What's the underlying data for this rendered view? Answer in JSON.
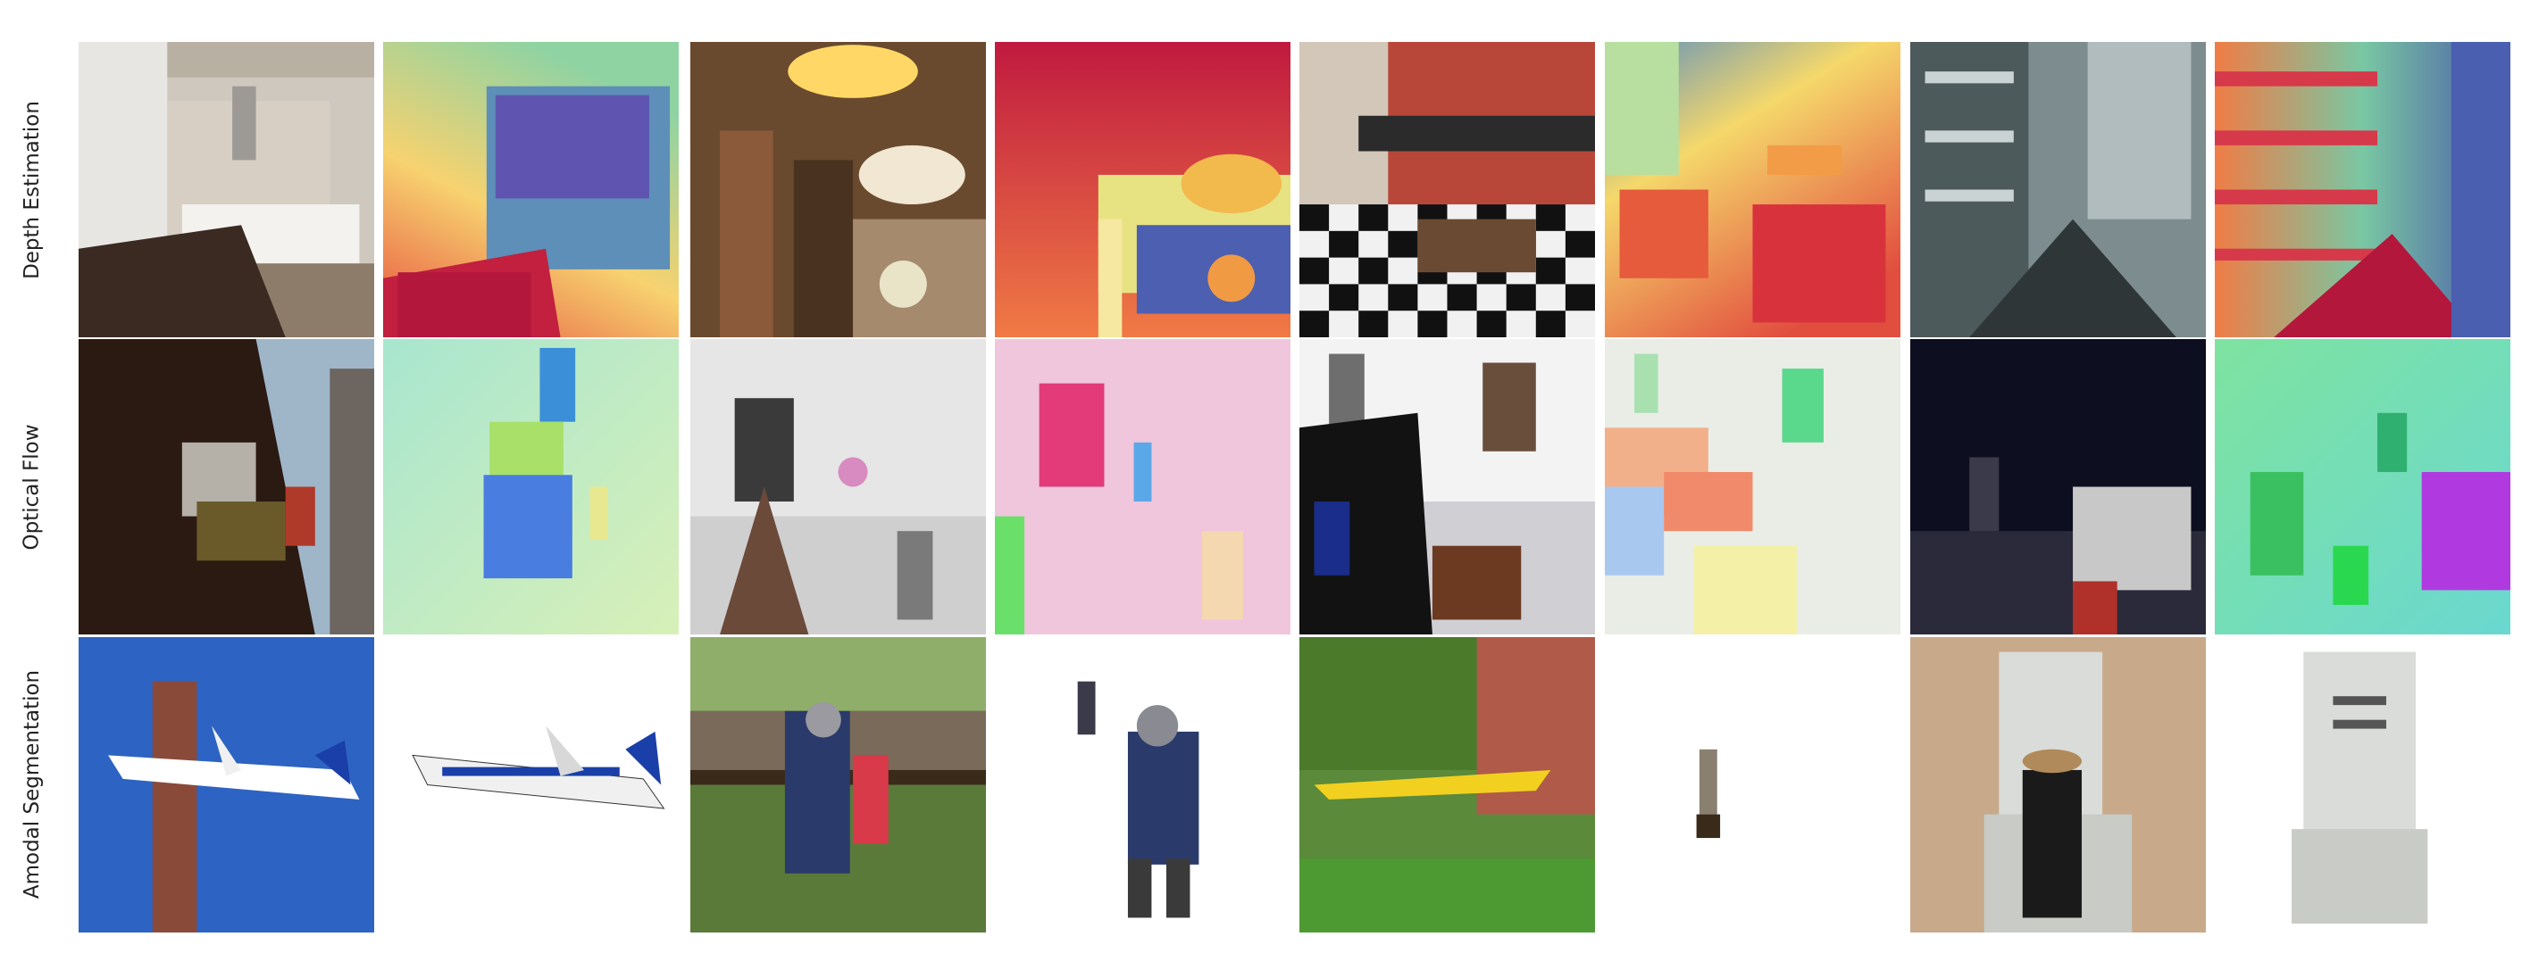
{
  "rows": [
    {
      "label": "Depth Estimation"
    },
    {
      "label": "Optical Flow"
    },
    {
      "label": "Amodal Segmentation"
    }
  ],
  "tiles": [
    {
      "row": 0,
      "col": 0,
      "kind": "photo",
      "content": "kitchen interior"
    },
    {
      "row": 0,
      "col": 1,
      "kind": "depth-map",
      "content": "kitchen depth"
    },
    {
      "row": 0,
      "col": 2,
      "kind": "photo",
      "content": "hotel lobby with chandelier"
    },
    {
      "row": 0,
      "col": 3,
      "kind": "depth-map",
      "content": "lobby depth"
    },
    {
      "row": 0,
      "col": 4,
      "kind": "photo",
      "content": "restaurant with checkered floor"
    },
    {
      "row": 0,
      "col": 5,
      "kind": "depth-map",
      "content": "restaurant depth"
    },
    {
      "row": 0,
      "col": 6,
      "kind": "photo",
      "content": "staircase with shelves"
    },
    {
      "row": 0,
      "col": 7,
      "kind": "depth-map",
      "content": "staircase depth"
    },
    {
      "row": 1,
      "col": 0,
      "kind": "photo",
      "content": "floating chairs over city"
    },
    {
      "row": 1,
      "col": 1,
      "kind": "flow-map",
      "content": "chairs flow"
    },
    {
      "row": 1,
      "col": 2,
      "kind": "photo",
      "content": "floating chairs in sky"
    },
    {
      "row": 1,
      "col": 3,
      "kind": "flow-map",
      "content": "chairs flow"
    },
    {
      "row": 1,
      "col": 4,
      "kind": "photo",
      "content": "chairs against clouds"
    },
    {
      "row": 1,
      "col": 5,
      "kind": "flow-map",
      "content": "chairs flow"
    },
    {
      "row": 1,
      "col": 6,
      "kind": "photo",
      "content": "chairs over city at night"
    },
    {
      "row": 1,
      "col": 7,
      "kind": "flow-map",
      "content": "chairs flow"
    },
    {
      "row": 2,
      "col": 0,
      "kind": "photo",
      "content": "airplane beside tower"
    },
    {
      "row": 2,
      "col": 1,
      "kind": "segmentation",
      "content": "airplane amodal"
    },
    {
      "row": 2,
      "col": 2,
      "kind": "photo",
      "content": "knight in armor with crowd"
    },
    {
      "row": 2,
      "col": 3,
      "kind": "segmentation",
      "content": "knight amodal"
    },
    {
      "row": 2,
      "col": 4,
      "kind": "photo",
      "content": "yellow plane in garden"
    },
    {
      "row": 2,
      "col": 5,
      "kind": "segmentation",
      "content": "small statue amodal"
    },
    {
      "row": 2,
      "col": 6,
      "kind": "photo",
      "content": "person in front of gravestone"
    },
    {
      "row": 2,
      "col": 7,
      "kind": "segmentation",
      "content": "gravestone amodal"
    }
  ],
  "colors": {
    "depth_near": "#b3173c",
    "depth_mid": "#f3a14d",
    "depth_far": "#4a5fb0",
    "sky_blue": "#2d63c2"
  }
}
